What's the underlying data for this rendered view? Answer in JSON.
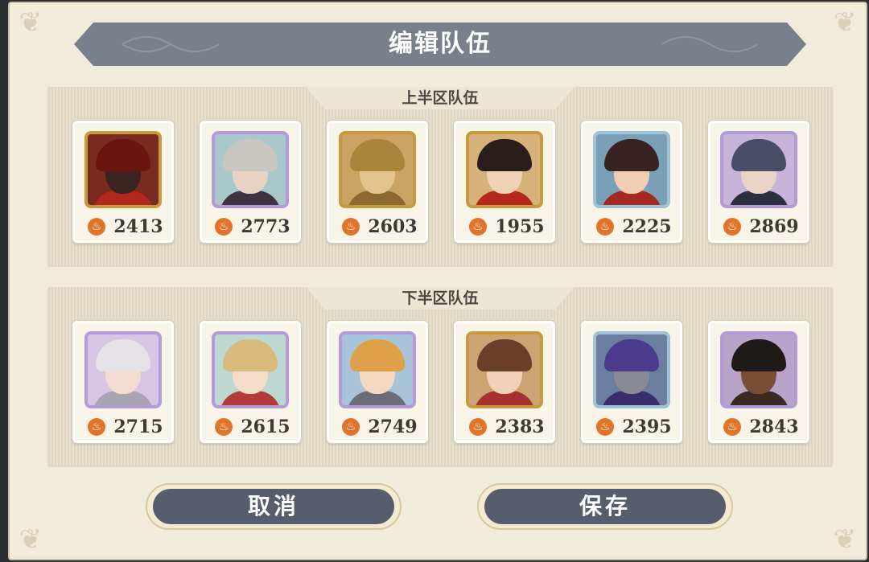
{
  "title": "编辑队伍",
  "sections": [
    {
      "label": "上半区队伍",
      "heroes": [
        {
          "power": "2413",
          "icon": "hero-portrait-red-hat-masked",
          "frame": "#c79a3e",
          "bg": "#7a2a1e",
          "hair": "#6b1410",
          "skin": "#3a2320",
          "outfit": "#b3271e"
        },
        {
          "power": "2773",
          "icon": "hero-portrait-silver-haired-man",
          "frame": "#b59ad8",
          "bg": "#a9c8cc",
          "hair": "#c9c6c2",
          "skin": "#e8d2c2",
          "outfit": "#3d3344"
        },
        {
          "power": "2603",
          "icon": "hero-portrait-golden-helmet",
          "frame": "#c79a3e",
          "bg": "#c9a464",
          "hair": "#a9853c",
          "skin": "#e4c48e",
          "outfit": "#8a6a30"
        },
        {
          "power": "1955",
          "icon": "hero-portrait-tricorn-hat",
          "frame": "#c79a3e",
          "bg": "#d4b27a",
          "hair": "#2a1d1b",
          "skin": "#f0d2b4",
          "outfit": "#b3271e"
        },
        {
          "power": "2225",
          "icon": "hero-portrait-dark-hat-woman",
          "frame": "#9fc2d8",
          "bg": "#7aa0b8",
          "hair": "#3b2222",
          "skin": "#f0cdb4",
          "outfit": "#a32a20"
        },
        {
          "power": "2869",
          "icon": "hero-portrait-blue-haired-man",
          "frame": "#b59ad8",
          "bg": "#c8b4d8",
          "hair": "#4a4d66",
          "skin": "#ead4c8",
          "outfit": "#2e2f3e"
        }
      ]
    },
    {
      "label": "下半区队伍",
      "heroes": [
        {
          "power": "2715",
          "icon": "hero-portrait-white-haired-youth",
          "frame": "#b59ad8",
          "bg": "#d6c6e4",
          "hair": "#e4e2e6",
          "skin": "#f2dcd0",
          "outfit": "#a8a4b2"
        },
        {
          "power": "2615",
          "icon": "hero-portrait-blonde-princess",
          "frame": "#b59ad8",
          "bg": "#bcd8d0",
          "hair": "#d8bb7c",
          "skin": "#f4dcc6",
          "outfit": "#b53a3a"
        },
        {
          "power": "2749",
          "icon": "hero-portrait-orange-haired-knight",
          "frame": "#b59ad8",
          "bg": "#a8c4d8",
          "hair": "#e0a04a",
          "skin": "#f4d8c0",
          "outfit": "#6a6c78"
        },
        {
          "power": "2383",
          "icon": "hero-portrait-brown-haired-woman",
          "frame": "#c79a3e",
          "bg": "#caa472",
          "hair": "#6b3e28",
          "skin": "#f0d0b8",
          "outfit": "#a83030"
        },
        {
          "power": "2395",
          "icon": "hero-portrait-purple-hooded-masked",
          "frame": "#9fc2d8",
          "bg": "#6a7ea0",
          "hair": "#4c3a8c",
          "skin": "#8a8a96",
          "outfit": "#3a2e6a"
        },
        {
          "power": "2843",
          "icon": "hero-portrait-dark-skinned-man",
          "frame": "#b59ad8",
          "bg": "#b8a4c8",
          "hair": "#1e1a18",
          "skin": "#7a4e34",
          "outfit": "#3a2a22"
        }
      ]
    }
  ],
  "buttons": {
    "cancel": "取消",
    "save": "保存"
  },
  "icons": {
    "power": "flame-icon"
  },
  "colors": {
    "banner": "#7a7f8e",
    "button": "#585d6e",
    "power_icon": "#e0742a",
    "panel_bg": "#f1ebdc"
  }
}
